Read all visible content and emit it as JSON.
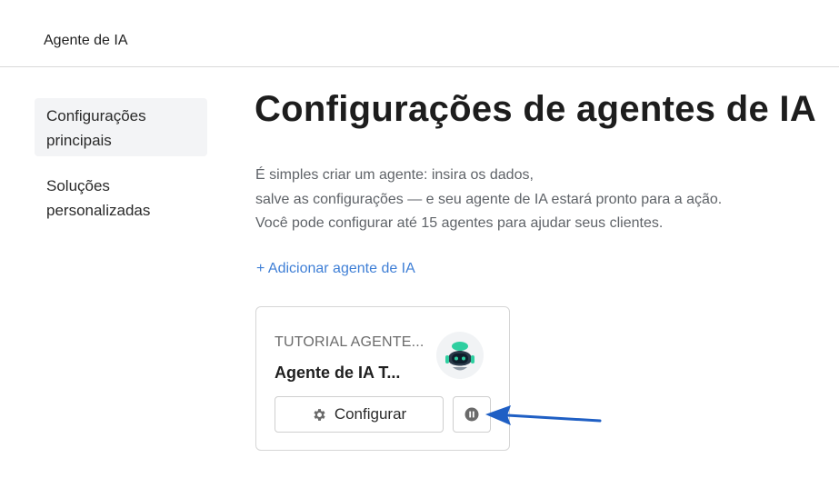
{
  "header": {
    "title": "Agente de IA"
  },
  "sidebar": {
    "items": [
      {
        "label": "Configurações principais",
        "line1": "Configurações",
        "line2": "principais",
        "active": true
      },
      {
        "label": "Soluções personalizadas",
        "line1": "Soluções",
        "line2": "personalizadas",
        "active": false
      }
    ]
  },
  "main": {
    "title": "Configurações de agentes de IA",
    "description": [
      "É simples criar um agente: insira os dados,",
      "salve as configurações — e seu agente de IA estará pronto para a ação.",
      "Você pode configurar até 15 agentes para ajudar seus clientes."
    ],
    "add_link": "+ Adicionar agente de IA"
  },
  "agent_card": {
    "subtitle": "TUTORIAL AGENTE...",
    "name": "Agente de IA T...",
    "avatar_icon": "robot-icon",
    "configure_label": "Configurar",
    "configure_icon": "gear-icon",
    "pause_icon": "pause-icon"
  },
  "annotation": {
    "icon": "arrow-pointer-icon",
    "color": "#1f5fc4"
  },
  "colors": {
    "link": "#3f7fd6",
    "active_bg": "#f3f4f6",
    "border": "#d6d6d6",
    "robot_accent": "#2ecfa0"
  }
}
